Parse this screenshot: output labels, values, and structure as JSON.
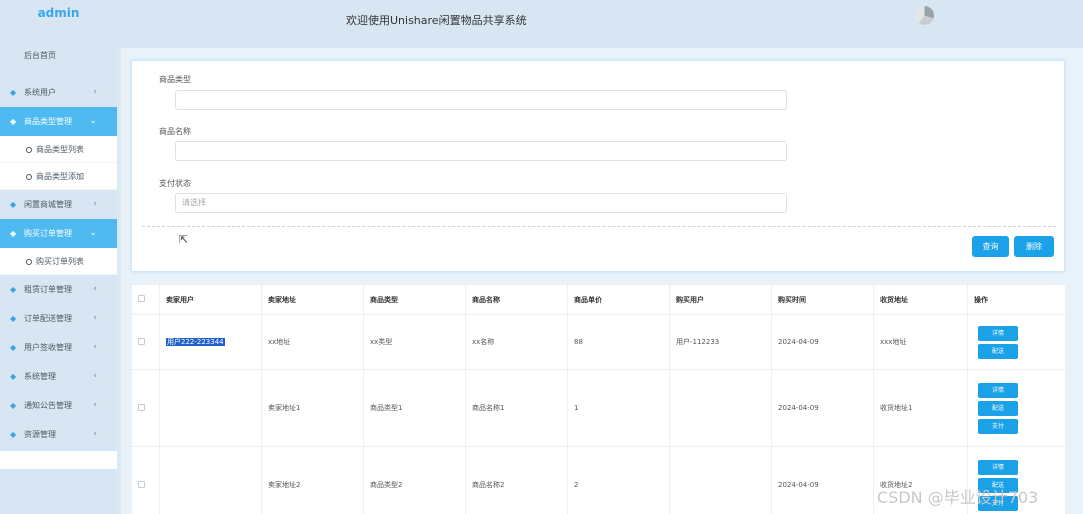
{
  "sidebar": {
    "brand": "admin",
    "home": "后台首页",
    "items": [
      {
        "label": "系统用户",
        "active": false
      },
      {
        "label": "商品类型管理",
        "active": true,
        "subs": [
          "商品类型列表",
          "商品类型添加"
        ]
      },
      {
        "label": "闲置商城管理",
        "active": false
      },
      {
        "label": "购买订单管理",
        "active": true,
        "subs": [
          "购买订单列表"
        ]
      },
      {
        "label": "租赁订单管理",
        "active": false
      },
      {
        "label": "订单配送管理",
        "active": false
      },
      {
        "label": "用户签收管理",
        "active": false
      },
      {
        "label": "系统管理",
        "active": false
      },
      {
        "label": "通知公告管理",
        "active": false
      },
      {
        "label": "资源管理",
        "active": false
      }
    ]
  },
  "header": {
    "title": "欢迎使用Unishare闲置物品共享系统"
  },
  "search": {
    "type_label": "商品类型",
    "type_value": "",
    "name_label": "商品名称",
    "name_value": "",
    "pay_label": "支付状态",
    "pay_placeholder": "请选择",
    "query_button": "查询",
    "delete_button": "删除"
  },
  "table": {
    "columns": [
      "卖家用户",
      "卖家地址",
      "商品类型",
      "商品名称",
      "商品单价",
      "购买用户",
      "购买时间",
      "收货地址",
      "操作"
    ],
    "rows": [
      {
        "seller": "用户222-223344",
        "address": "xx地址",
        "type": "xx类型",
        "name": "xx名称",
        "price": "88",
        "buyer": "用户-112233",
        "time": "2024-04-09",
        "delivery": "xxx地址",
        "ops": [
          "详情",
          "配送"
        ]
      },
      {
        "seller": "",
        "address": "卖家地址1",
        "type": "商品类型1",
        "name": "商品名称1",
        "price": "1",
        "buyer": "",
        "time": "2024-04-09",
        "delivery": "收货地址1",
        "ops": [
          "详情",
          "配送",
          "支付"
        ]
      },
      {
        "seller": "",
        "address": "卖家地址2",
        "type": "商品类型2",
        "name": "商品名称2",
        "price": "2",
        "buyer": "",
        "time": "2024-04-09",
        "delivery": "收货地址2",
        "ops": [
          "详情",
          "配送",
          "支付"
        ]
      }
    ]
  },
  "watermark": "CSDN @毕业设计703",
  "colors": {
    "accent": "#1aa1e8",
    "active_menu": "#4ebaf1",
    "sidebar_bg": "#d7e6f2",
    "brand": "#39a8ea"
  }
}
